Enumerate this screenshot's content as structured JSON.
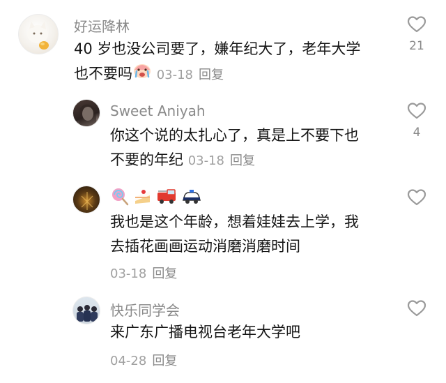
{
  "comments": [
    {
      "username": "好运降林",
      "line1": "40 岁也没公司要了，嫌年纪大了，老年大学",
      "line2": "也不要吗",
      "emoji": "crying-face",
      "date": "03-18",
      "reply": "回复",
      "likes": "21"
    },
    {
      "username": "Sweet Aniyah",
      "line1": "你这个说的太扎心了，真是上不要下也",
      "line2": "不要的年纪",
      "date": "03-18",
      "reply": "回复",
      "likes": "4"
    },
    {
      "username_emojis": [
        "lollipop",
        "shortcake",
        "fire-engine",
        "police-car"
      ],
      "line1": "我也是这个年龄，想着娃娃去上学，我",
      "line2": "去插花画画运动消磨消磨时间",
      "date": "03-18",
      "reply": "回复"
    },
    {
      "username": "快乐同学会",
      "line1": "来广东广播电视台老年大学吧",
      "date": "04-28",
      "reply": "回复"
    }
  ]
}
